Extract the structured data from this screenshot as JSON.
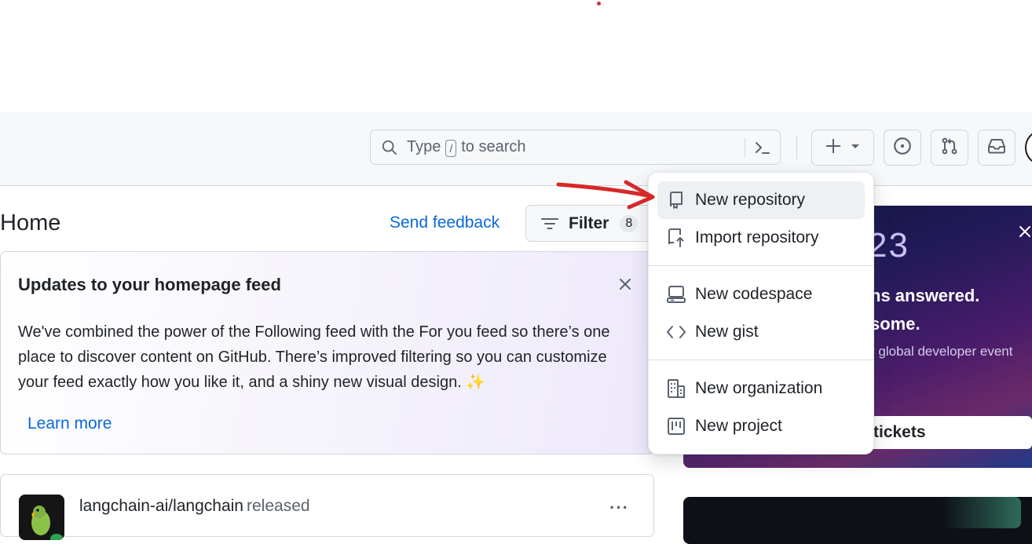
{
  "header": {
    "search_prefix": "Type",
    "search_key": "/",
    "search_suffix": "to search",
    "icons": [
      "search-icon",
      "command-palette-icon",
      "plus-icon",
      "chevron-down-icon",
      "issue-icon",
      "pull-request-icon",
      "inbox-icon"
    ]
  },
  "main": {
    "title": "Home",
    "send_feedback": "Send feedback",
    "filter_label": "Filter",
    "filter_count": "8"
  },
  "updates_card": {
    "title": "Updates to your homepage feed",
    "body": "We've combined the power of the Following feed with the For you feed so there’s one place to discover content on GitHub. There’s improved filtering so you can customize your feed exactly how you like it, and a shiny new visual design.",
    "emoji": "✨",
    "learn_more": "Learn more"
  },
  "feed": {
    "repo": "langchain-ai/langchain",
    "action": "released",
    "more": "···"
  },
  "promo": {
    "year_fragment": "23",
    "line1": "ns answered.",
    "line2": "some.",
    "line3": "r global developer event",
    "button": "tickets"
  },
  "menu": {
    "items": [
      {
        "label": "New repository",
        "icon": "repo-icon"
      },
      {
        "label": "Import repository",
        "icon": "repo-push-icon"
      },
      {
        "label": "New codespace",
        "icon": "codespace-icon"
      },
      {
        "label": "New gist",
        "icon": "code-icon"
      },
      {
        "label": "New organization",
        "icon": "organization-icon"
      },
      {
        "label": "New project",
        "icon": "project-icon"
      }
    ]
  },
  "colors": {
    "accent": "#0969da",
    "annotation_arrow": "#d62828",
    "menu_hover": "#eef0f3"
  }
}
